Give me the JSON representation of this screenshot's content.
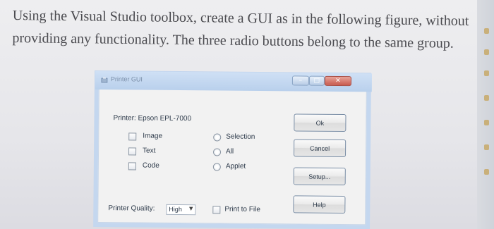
{
  "instruction": {
    "text": "Using the Visual Studio toolbox, create a GUI as in the following figure, without providing any functionality. The three radio buttons belong to the same group."
  },
  "window": {
    "title": "Printer GUI",
    "printer_label": "Printer: Epson EPL-7000",
    "checkboxes": [
      {
        "label": "Image",
        "checked": false
      },
      {
        "label": "Text",
        "checked": false
      },
      {
        "label": "Code",
        "checked": false
      }
    ],
    "radios": [
      {
        "label": "Selection",
        "selected": false
      },
      {
        "label": "All",
        "selected": false
      },
      {
        "label": "Applet",
        "selected": false
      }
    ],
    "buttons": {
      "ok": "Ok",
      "cancel": "Cancel",
      "setup": "Setup...",
      "help": "Help"
    },
    "print_quality": {
      "label": "Printer Quality:",
      "value": "High"
    },
    "print_to_file": {
      "label": "Print to File",
      "checked": false
    }
  },
  "colors": {
    "window_frame": "#c4d7ef",
    "close_button": "#c85a4e"
  }
}
